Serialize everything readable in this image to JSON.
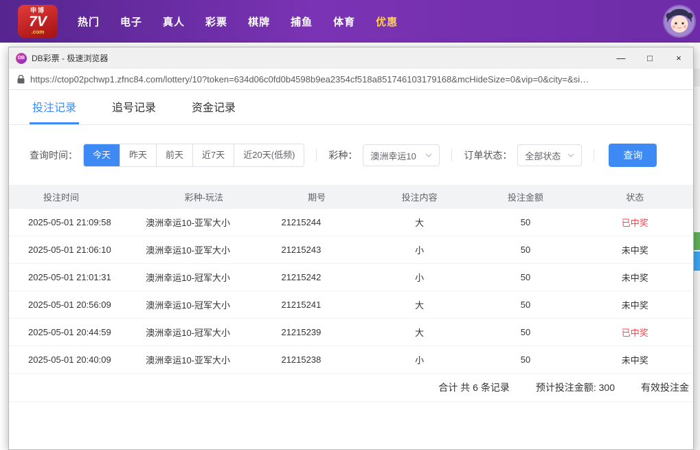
{
  "colors": {
    "accent_blue": "#3d8af5",
    "win_red": "#f5464d",
    "brand_purple_start": "#56258f",
    "brand_purple_end": "#7a33b4",
    "highlight_gold": "#ffd23e"
  },
  "top_nav": {
    "logo": {
      "brand_top": "申博",
      "brand_main": "7V",
      "brand_suffix": ".com"
    },
    "items": [
      {
        "key": "hot",
        "label": "热门",
        "highlight": false
      },
      {
        "key": "slots",
        "label": "电子",
        "highlight": false
      },
      {
        "key": "live",
        "label": "真人",
        "highlight": false
      },
      {
        "key": "lottery",
        "label": "彩票",
        "highlight": false
      },
      {
        "key": "board-games",
        "label": "棋牌",
        "highlight": false
      },
      {
        "key": "fishing",
        "label": "捕鱼",
        "highlight": false
      },
      {
        "key": "sports",
        "label": "体育",
        "highlight": false
      },
      {
        "key": "promotions",
        "label": "优惠",
        "highlight": true
      }
    ]
  },
  "browser": {
    "favicon_text": "DB",
    "title": "DB彩票 - 极速浏览器",
    "url": "https://ctop02pchwp1.zfnc84.com/lottery/10?token=634d06c0fd0b4598b9ea2354cf518a851746103179168&mcHideSize=0&vip=0&city=&si…",
    "controls": {
      "minimize": "—",
      "maximize": "□",
      "close": "×"
    }
  },
  "tabs": [
    {
      "key": "bet-records",
      "label": "投注记录",
      "active": true
    },
    {
      "key": "chase-records",
      "label": "追号记录",
      "active": false
    },
    {
      "key": "fund-records",
      "label": "资金记录",
      "active": false
    }
  ],
  "filters": {
    "time_label": "查询时间：",
    "time_options": [
      {
        "key": "today",
        "label": "今天",
        "active": true
      },
      {
        "key": "yesterday",
        "label": "昨天",
        "active": false
      },
      {
        "key": "day-before",
        "label": "前天",
        "active": false
      },
      {
        "key": "last-7-days",
        "label": "近7天",
        "active": false
      },
      {
        "key": "last-20-days",
        "label": "近20天(低频)",
        "active": false
      }
    ],
    "lottery_label": "彩种：",
    "lottery_value": "澳洲幸运10",
    "status_label": "订单状态：",
    "status_value": "全部状态",
    "search_button": "查询"
  },
  "table": {
    "headers": [
      "投注时间",
      "彩种-玩法",
      "期号",
      "投注内容",
      "投注金额",
      "状态"
    ],
    "column_keys": [
      "time",
      "game",
      "issue",
      "content",
      "amount",
      "status"
    ],
    "rows": [
      {
        "time": "2025-05-01 21:09:58",
        "game": "澳洲幸运10-亚军大小",
        "issue": "21215244",
        "content": "大",
        "amount": "50",
        "status": "已中奖",
        "won": true
      },
      {
        "time": "2025-05-01 21:06:10",
        "game": "澳洲幸运10-亚军大小",
        "issue": "21215243",
        "content": "小",
        "amount": "50",
        "status": "未中奖",
        "won": false
      },
      {
        "time": "2025-05-01 21:01:31",
        "game": "澳洲幸运10-冠军大小",
        "issue": "21215242",
        "content": "小",
        "amount": "50",
        "status": "未中奖",
        "won": false
      },
      {
        "time": "2025-05-01 20:56:09",
        "game": "澳洲幸运10-冠军大小",
        "issue": "21215241",
        "content": "大",
        "amount": "50",
        "status": "未中奖",
        "won": false
      },
      {
        "time": "2025-05-01 20:44:59",
        "game": "澳洲幸运10-冠军大小",
        "issue": "21215239",
        "content": "大",
        "amount": "50",
        "status": "已中奖",
        "won": true
      },
      {
        "time": "2025-05-01 20:40:09",
        "game": "澳洲幸运10-亚军大小",
        "issue": "21215238",
        "content": "小",
        "amount": "50",
        "status": "未中奖",
        "won": false
      }
    ]
  },
  "summary": {
    "total": "合计 共 6 条记录",
    "expected": "预计投注金额: 300",
    "valid": "有效投注金"
  }
}
